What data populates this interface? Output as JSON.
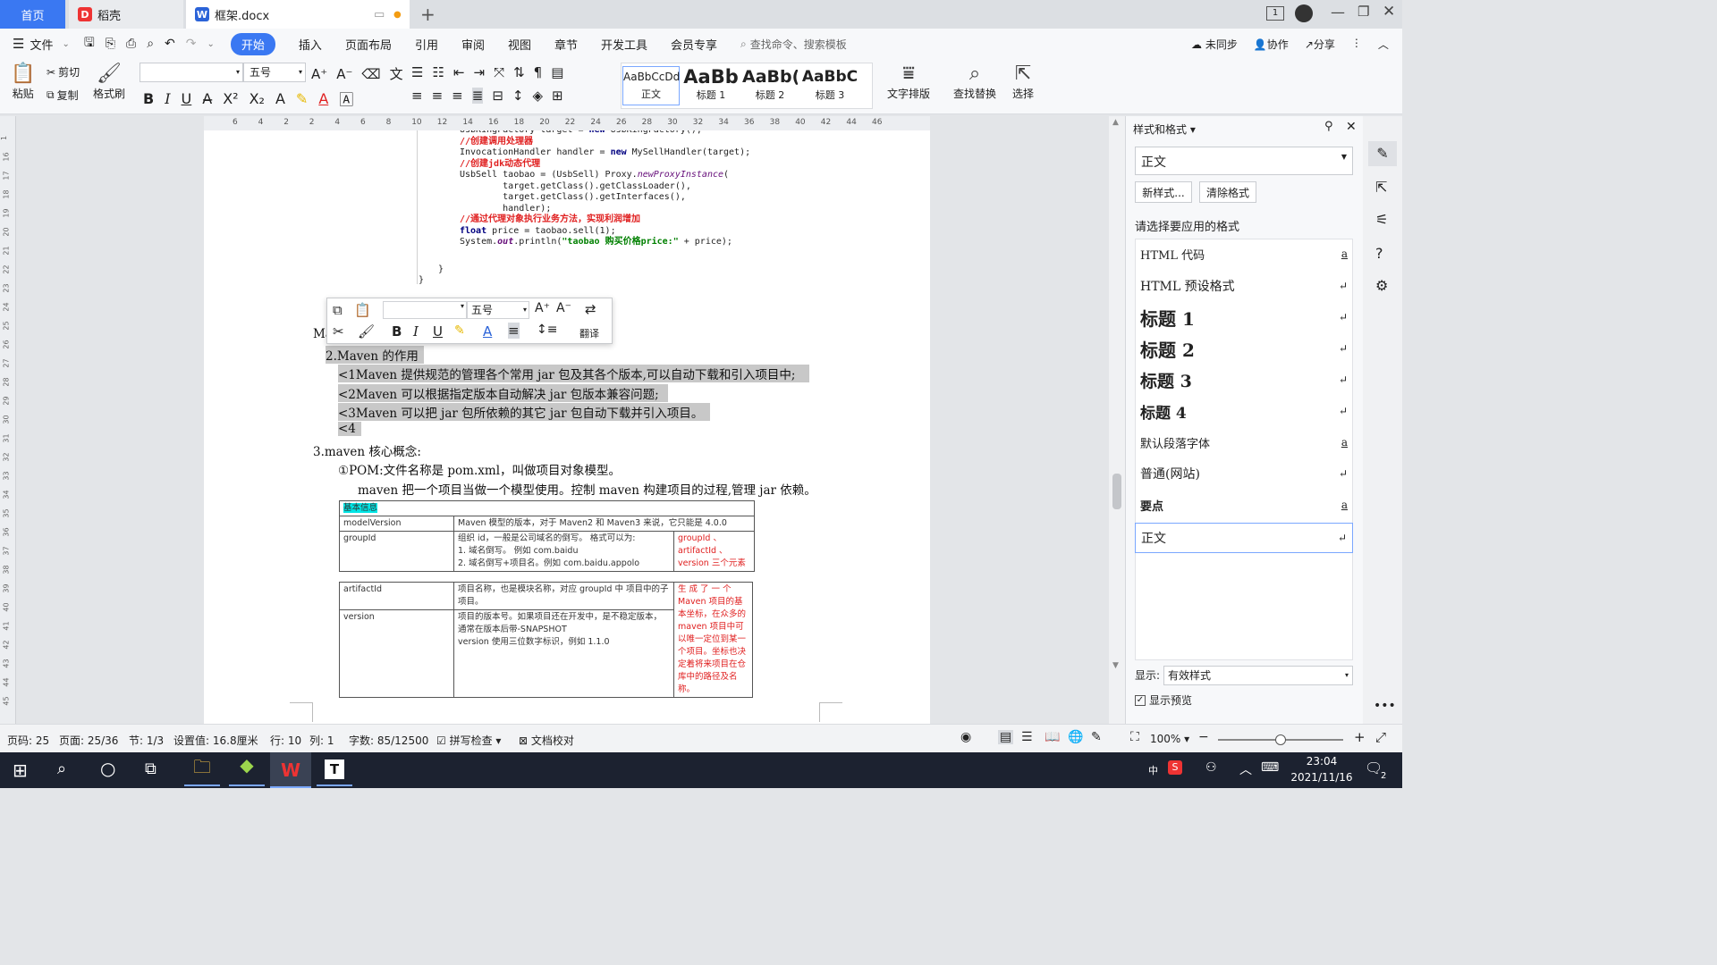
{
  "tabs": {
    "home": "首页",
    "daoke": "稻壳",
    "doc": "框架.docx",
    "badge": "1"
  },
  "menu": [
    "文件",
    "开始",
    "插入",
    "页面布局",
    "引用",
    "审阅",
    "视图",
    "章节",
    "开发工具",
    "会员专享"
  ],
  "search_placeholder": "查找命令、搜索模板",
  "top_right": {
    "sync": "未同步",
    "collab": "协作",
    "share": "分享"
  },
  "ribbon": {
    "paste": "粘贴",
    "cut": "剪切",
    "copy": "复制",
    "format_painter": "格式刷",
    "font_name": "",
    "font_size": "五号",
    "styles": [
      {
        "sample": "AaBbCcDd",
        "label": "正文"
      },
      {
        "sample": "AaBb",
        "label": "标题 1"
      },
      {
        "sample": "AaBb(",
        "label": "标题 2"
      },
      {
        "sample": "AaBbC",
        "label": "标题 3"
      }
    ],
    "text_layout": "文字排版",
    "find_replace": "查找替换",
    "select": "选择"
  },
  "left_ruler": [
    "1",
    "16",
    "17",
    "18",
    "19",
    "20",
    "21",
    "22",
    "23",
    "24",
    "25",
    "26",
    "27",
    "28",
    "29",
    "30",
    "31",
    "32",
    "33",
    "34",
    "35",
    "36",
    "37",
    "38",
    "39",
    "40",
    "41",
    "42",
    "43",
    "44",
    "45"
  ],
  "top_ruler": [
    "6",
    "4",
    "2",
    "2",
    "4",
    "6",
    "8",
    "10",
    "12",
    "14",
    "16",
    "18",
    "20",
    "22",
    "24",
    "26",
    "28",
    "30",
    "32",
    "34",
    "36",
    "38",
    "40",
    "42",
    "44",
    "46"
  ],
  "mini_toolbar": {
    "font_size": "五号",
    "translate": "翻译"
  },
  "document": {
    "code_lines": [
      {
        "text": "UsbKingFactory target = new UsbKingFactory();",
        "kind": "plain"
      },
      {
        "text": "//创建调用处理器",
        "kind": "comment"
      },
      {
        "text": "InvocationHandler handler = new MySellHandler(target);",
        "kind": "plain"
      },
      {
        "text": "//创建jdk动态代理",
        "kind": "comment"
      },
      {
        "text": "UsbSell taobao = (UsbSell) Proxy.newProxyInstance(",
        "kind": "plain"
      },
      {
        "text": "        target.getClass().getClassLoader(),",
        "kind": "plain"
      },
      {
        "text": "        target.getClass().getInterfaces(),",
        "kind": "plain"
      },
      {
        "text": "        handler);",
        "kind": "plain"
      },
      {
        "text": "//通过代理对象执行业务方法，实现利润增加",
        "kind": "comment"
      },
      {
        "text": "float price = taobao.sell(1);",
        "kind": "plain"
      },
      {
        "text": "System.out.println(\"taobao 购买价格price:\" + price);",
        "kind": "plain"
      }
    ],
    "brace_inner": "}",
    "brace_outer": "}",
    "ma_fragment": "Ma",
    "sec2": "2.Maven 的作用",
    "sec2_items": [
      "<1Maven 提供规范的管理各个常用 jar 包及其各个版本,可以自动下载和引入项目中;",
      "<2Maven 可以根据指定版本自动解决 jar 包版本兼容问题;",
      "<3Maven 可以把 jar 包所依赖的其它 jar 包自动下载并引入项目。",
      "<4"
    ],
    "sec3": "3.maven 核心概念:",
    "pom_line": "①POM:文件名称是 pom.xml，叫做项目对象模型。",
    "pom_desc": "maven 把一个项目当做一个模型使用。控制 maven 构建项目的过程,管理 jar 依赖。",
    "table1": {
      "header": "基本信息",
      "rows": [
        {
          "k": "modelVersion",
          "v": "Maven 模型的版本，对于 Maven2 和 Maven3 来说，它只能是 4.0.0",
          "n": ""
        },
        {
          "k": "groupId",
          "v": "组织 id，一般是公司域名的倒写。 格式可以为:\n1. 域名倒写。 例如 com.baidu\n2. 域名倒写+项目名。例如 com.baidu.appolo",
          "n": "groupId 、\nartifactId 、\nversion 三个元素"
        }
      ]
    },
    "table2": {
      "rows": [
        {
          "k": "artifactId",
          "v": "项目名称，也是模块名称，对应 groupId 中 项目中的子项目。",
          "n": "生 成 了 一 个\nMaven 项目的基\n本坐标，在众多的\nmaven 项目中可\n以唯一定位到某一\n个项目。坐标也决\n定着将来项目在仓\n库中的路径及名\n称。"
        },
        {
          "k": "version",
          "v": "项目的版本号。如果项目还在开发中，是不稳定版本，通常在版本后带-SNAPSHOT\nversion 使用三位数字标识，例如 1.1.0",
          "n": ""
        }
      ]
    }
  },
  "styles_pane": {
    "title": "样式和格式",
    "current": "正文",
    "new_style": "新样式...",
    "clear": "清除格式",
    "prompt": "请选择要应用的格式",
    "items": [
      {
        "label": "HTML 代码",
        "mark": "a"
      },
      {
        "label": "HTML 预设格式",
        "mark": "↵"
      },
      {
        "label": "标题 1",
        "mark": "↵"
      },
      {
        "label": "标题 2",
        "mark": "↵"
      },
      {
        "label": "标题 3",
        "mark": "↵"
      },
      {
        "label": "标题 4",
        "mark": "↵"
      },
      {
        "label": "默认段落字体",
        "mark": "a"
      },
      {
        "label": "普通(网站)",
        "mark": "↵"
      },
      {
        "label": "要点",
        "mark": "a"
      },
      {
        "label": "正文",
        "mark": "↵"
      }
    ],
    "show_label": "显示:",
    "show_value": "有效样式",
    "preview": "显示预览"
  },
  "status": {
    "page_code": "页码: 25",
    "page": "页面: 25/36",
    "section": "节: 1/3",
    "setting": "设置值: 16.8厘米",
    "row": "行: 10",
    "col": "列: 1",
    "words": "字数: 85/12500",
    "spell": "拼写检查",
    "proof": "文档校对",
    "zoom": "100%"
  },
  "taskbar": {
    "time": "23:04",
    "date": "2021/11/16",
    "ime": "中",
    "notify": "2"
  }
}
